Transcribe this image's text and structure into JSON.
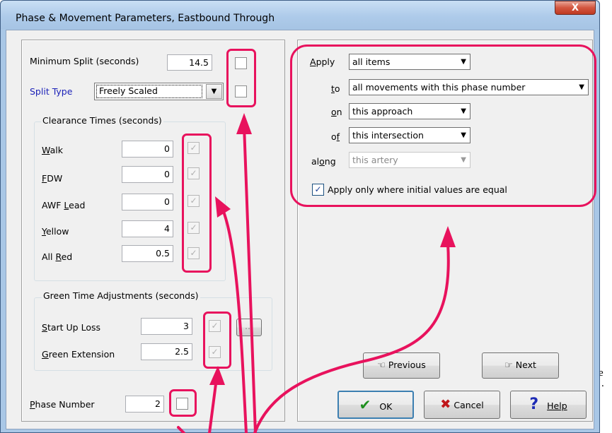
{
  "window": {
    "title": "Phase & Movement Parameters, Eastbound Through",
    "close": "X"
  },
  "left": {
    "min_split": {
      "label": "Minimum Split (seconds)",
      "value": "14.5"
    },
    "split_type": {
      "label": "Split Type",
      "value": "Freely Scaled"
    },
    "clearance": {
      "title": "Clearance Times (seconds)",
      "rows": [
        {
          "label": "Walk",
          "value": "0"
        },
        {
          "label": "FDW",
          "value": "0"
        },
        {
          "label": "AWF Lead",
          "value": "0"
        },
        {
          "label": "Yellow",
          "value": "4"
        },
        {
          "label": "All Red",
          "value": "0.5"
        }
      ]
    },
    "green": {
      "title": "Green Time Adjustments (seconds)",
      "rows": [
        {
          "label": "Start Up Loss",
          "value": "3"
        },
        {
          "label": "Green Extension",
          "value": "2.5"
        }
      ],
      "more_button": "..."
    },
    "phase_number": {
      "label": "Phase Number",
      "value": "2"
    }
  },
  "apply": {
    "rows": [
      {
        "label": "Apply",
        "value": "all items"
      },
      {
        "label": "to",
        "value": "all movements with this phase number"
      },
      {
        "label": "on",
        "value": "this approach"
      },
      {
        "label": "of",
        "value": "this intersection"
      },
      {
        "label": "along",
        "value": "this artery"
      }
    ],
    "checkbox_label": "Apply only where initial values are equal"
  },
  "buttons": {
    "previous": "Previous",
    "next": "Next",
    "ok": "OK",
    "cancel": "Cancel",
    "help": "Help"
  },
  "side_text": {
    "a": "e",
    "b": "."
  },
  "colors": {
    "highlight": "#e8125d",
    "title_bg": "#b8d3ee"
  }
}
